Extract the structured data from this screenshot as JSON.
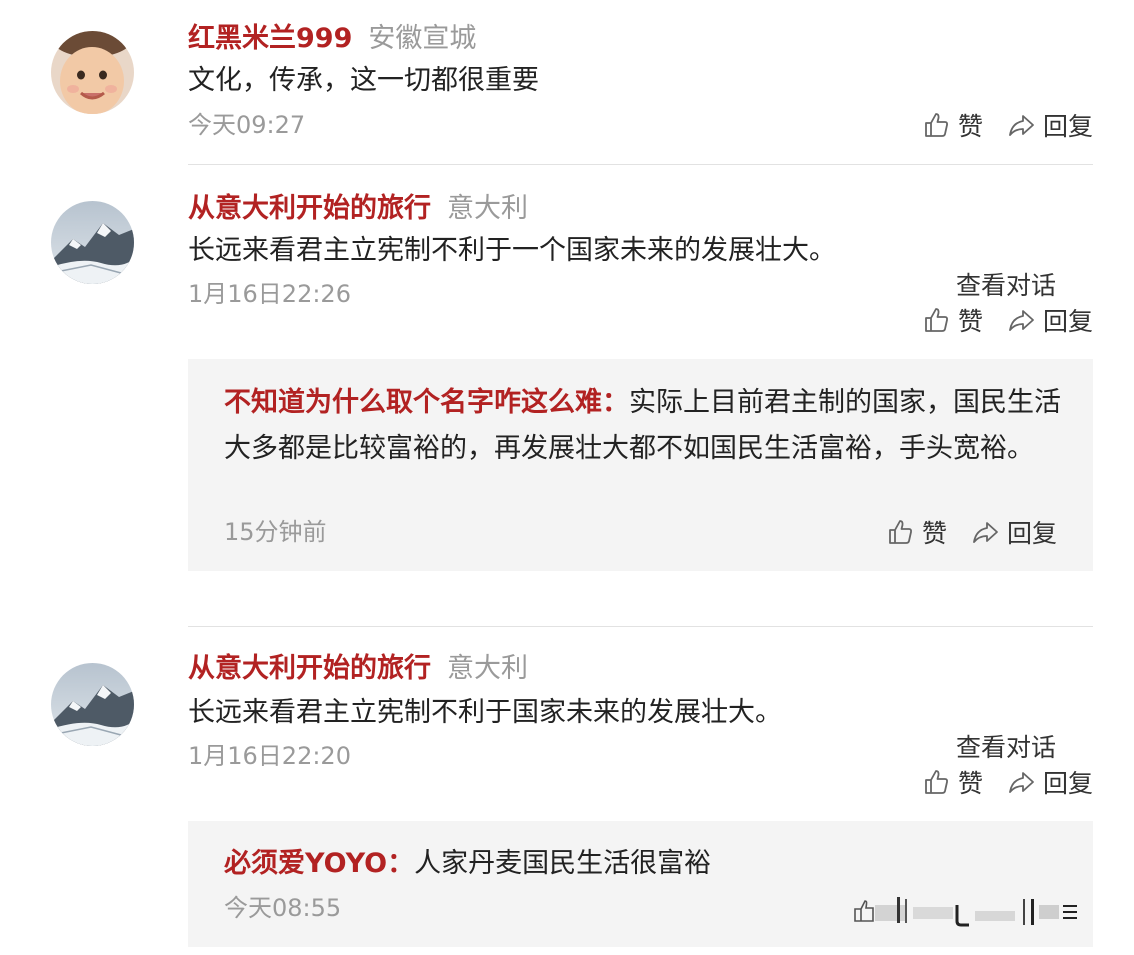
{
  "comments": [
    {
      "username": "红黑米兰999",
      "location": "安徽宣城",
      "text": "文化，传承，这一切都很重要",
      "time": "今天09:27",
      "like_label": "赞",
      "reply_label": "回复",
      "avatar": "baby-face-avatar"
    },
    {
      "username": "从意大利开始的旅行",
      "location": "意大利",
      "text": "长远来看君主立宪制不利于一个国家未来的发展壮大。",
      "time": "1月16日22:26",
      "view_conversation": "查看对话",
      "like_label": "赞",
      "reply_label": "回复",
      "avatar": "snowy-mountain-avatar",
      "reply": {
        "author": "不知道为什么取个名字咋这么难：",
        "text": "实际上目前君主制的国家，国民生活大多都是比较富裕的，再发展壮大都不如国民生活富裕，手头宽裕。",
        "time": "15分钟前",
        "like_label": "赞",
        "reply_label": "回复"
      }
    },
    {
      "username": "从意大利开始的旅行",
      "location": "意大利",
      "text": "长远来看君主立宪制不利于国家未来的发展壮大。",
      "time": "1月16日22:20",
      "view_conversation": "查看对话",
      "like_label": "赞",
      "reply_label": "回复",
      "avatar": "snowy-mountain-avatar",
      "reply": {
        "author": "必须爱YOYO：",
        "text": "人家丹麦国民生活很富裕",
        "time": "今天08:55"
      }
    }
  ],
  "colors": {
    "username": "#b22222",
    "meta": "#9a9a9a",
    "text": "#222222",
    "reply_bg": "#f4f4f4",
    "divider": "#e2e2e2"
  },
  "icons": {
    "like": "thumbs-up-icon",
    "reply": "share-arrow-icon"
  }
}
